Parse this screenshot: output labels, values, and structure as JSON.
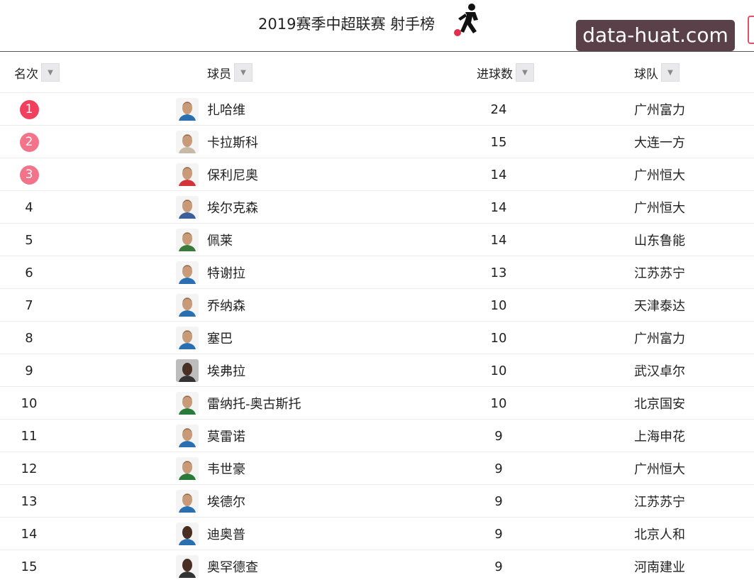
{
  "header": {
    "title": "2019赛季中超联赛 射手榜",
    "watermark": "data-huat.com"
  },
  "columns": {
    "rank": "名次",
    "player": "球员",
    "goals": "进球数",
    "team": "球队"
  },
  "colors": {
    "badge_1": "#f0405e",
    "badge_2": "#f3738a",
    "badge_3": "#f3738a",
    "jersey": [
      "#2a6fb0",
      "#c8b8a6",
      "#d2343a",
      "#3a5f9a",
      "#3a7a3a",
      "#2a6fb0",
      "#2a6fb0",
      "#2a6fb0",
      "#333333",
      "#2a7a3a",
      "#2a6fb0",
      "#2a7a3a",
      "#2a6fb0",
      "#2a6fb0",
      "#333333"
    ]
  },
  "rows": [
    {
      "rank": "1",
      "name": "扎哈维",
      "goals": "24",
      "team": "广州富力"
    },
    {
      "rank": "2",
      "name": "卡拉斯科",
      "goals": "15",
      "team": "大连一方"
    },
    {
      "rank": "3",
      "name": "保利尼奥",
      "goals": "14",
      "team": "广州恒大"
    },
    {
      "rank": "4",
      "name": "埃尔克森",
      "goals": "14",
      "team": "广州恒大"
    },
    {
      "rank": "5",
      "name": "佩莱",
      "goals": "14",
      "team": "山东鲁能"
    },
    {
      "rank": "6",
      "name": "特谢拉",
      "goals": "13",
      "team": "江苏苏宁"
    },
    {
      "rank": "7",
      "name": "乔纳森",
      "goals": "10",
      "team": "天津泰达"
    },
    {
      "rank": "8",
      "name": "塞巴",
      "goals": "10",
      "team": "广州富力"
    },
    {
      "rank": "9",
      "name": "埃弗拉",
      "goals": "10",
      "team": "武汉卓尔"
    },
    {
      "rank": "10",
      "name": "雷纳托-奥古斯托",
      "goals": "10",
      "team": "北京国安"
    },
    {
      "rank": "11",
      "name": "莫雷诺",
      "goals": "9",
      "team": "上海申花"
    },
    {
      "rank": "12",
      "name": "韦世豪",
      "goals": "9",
      "team": "广州恒大"
    },
    {
      "rank": "13",
      "name": "埃德尔",
      "goals": "9",
      "team": "江苏苏宁"
    },
    {
      "rank": "14",
      "name": "迪奥普",
      "goals": "9",
      "team": "北京人和"
    },
    {
      "rank": "15",
      "name": "奥罕德查",
      "goals": "9",
      "team": "河南建业"
    }
  ]
}
